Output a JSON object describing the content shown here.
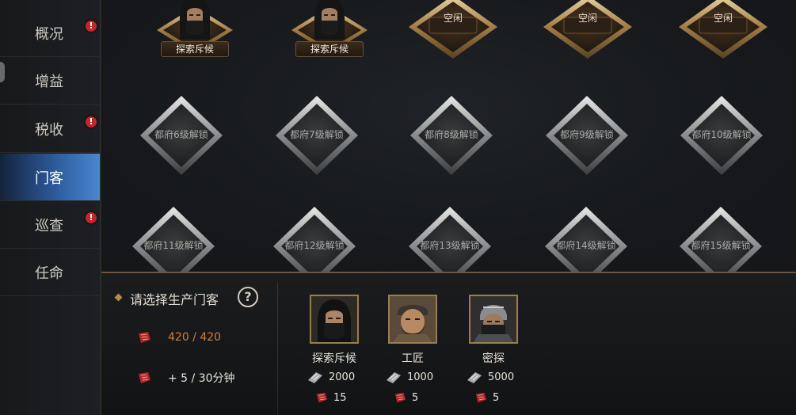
{
  "sidebar": {
    "items": [
      {
        "label": "概况",
        "badge": "!",
        "active": false
      },
      {
        "label": "增益",
        "badge": "",
        "active": false
      },
      {
        "label": "税收",
        "badge": "!",
        "active": false
      },
      {
        "label": "门客",
        "badge": "",
        "active": true
      },
      {
        "label": "巡查",
        "badge": "!",
        "active": false
      },
      {
        "label": "任命",
        "badge": "",
        "active": false
      }
    ]
  },
  "slots": {
    "row1": [
      {
        "state": "occupied",
        "label": "探索斥候",
        "icon": "hooded-scout-avatar"
      },
      {
        "state": "occupied",
        "label": "探索斥候",
        "icon": "hooded-scout-avatar"
      },
      {
        "state": "idle",
        "label": "空闲"
      },
      {
        "state": "idle",
        "label": "空闲"
      },
      {
        "state": "idle",
        "label": "空闲"
      }
    ],
    "row2": [
      "都府6级解锁",
      "都府7级解锁",
      "都府8级解锁",
      "都府9级解锁",
      "都府10级解锁"
    ],
    "row3": [
      "都府11级解锁",
      "都府12级解锁",
      "都府13级解锁",
      "都府14级解锁",
      "都府15级解锁"
    ]
  },
  "panel": {
    "prompt": "请选择生产门客",
    "help": "?",
    "capacity": "420 / 420",
    "rate": "+ 5 / 30分钟",
    "heroes": [
      {
        "name": "探索斥候",
        "cost_a": "2000",
        "cost_b": "15",
        "portrait": "hooded-scout-portrait"
      },
      {
        "name": "工匠",
        "cost_a": "1000",
        "cost_b": "5",
        "portrait": "craftsman-portrait"
      },
      {
        "name": "密探",
        "cost_a": "5000",
        "cost_b": "5",
        "portrait": "helmeted-spy-portrait"
      }
    ]
  },
  "colors": {
    "accent_gold": "#b58d4a",
    "active_blue": "#3f74c0",
    "badge_red": "#c8232b",
    "capacity_orange": "#d27e3d"
  }
}
